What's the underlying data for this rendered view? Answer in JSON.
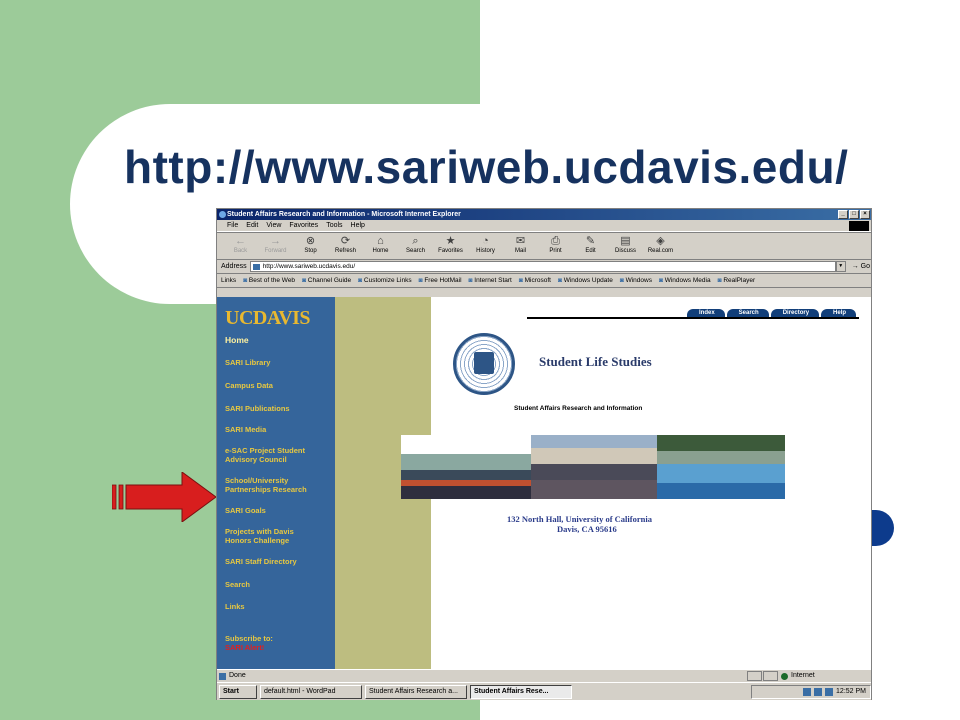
{
  "slide": {
    "title": "http://www.sariweb.ucdavis.edu/",
    "colors": {
      "green_panel": "#9ccb99",
      "title": "#16325f",
      "arrow": "#d81e1e",
      "bullet": "#0d3b8c"
    }
  },
  "window": {
    "title": "Student Affairs Research and Information - Microsoft Internet Explorer",
    "menu": [
      "File",
      "Edit",
      "View",
      "Favorites",
      "Tools",
      "Help"
    ],
    "toolbar": [
      {
        "label": "Back",
        "icon": "←"
      },
      {
        "label": "Forward",
        "icon": "→"
      },
      {
        "label": "Stop",
        "icon": "⊗"
      },
      {
        "label": "Refresh",
        "icon": "⟳"
      },
      {
        "label": "Home",
        "icon": "⌂"
      },
      {
        "label": "Search",
        "icon": "⌕"
      },
      {
        "label": "Favorites",
        "icon": "★"
      },
      {
        "label": "History",
        "icon": "◔"
      },
      {
        "label": "Mail",
        "icon": "✉"
      },
      {
        "label": "Print",
        "icon": "⎙"
      },
      {
        "label": "Edit",
        "icon": "✎"
      },
      {
        "label": "Discuss",
        "icon": "▤"
      },
      {
        "label": "Real.com",
        "icon": "◈"
      }
    ],
    "address_label": "Address",
    "address": "http://www.sariweb.ucdavis.edu/",
    "go": "Go",
    "links_label": "Links",
    "links": [
      "Best of the Web",
      "Channel Guide",
      "Customize Links",
      "Free HotMail",
      "Internet Start",
      "Microsoft",
      "Windows Update",
      "Windows",
      "Windows Media",
      "RealPlayer"
    ]
  },
  "site": {
    "logo": "UCDAVIS",
    "nav": [
      "Home",
      "SARI Library",
      "Campus Data",
      "SARI Publications",
      "SARI Media",
      "e-SAC Project Student Advisory Council",
      "School/University Partnerships Research",
      "SARI Goals",
      "Projects with Davis Honors Challenge",
      "SARI Staff Directory",
      "Search",
      "Links"
    ],
    "subscribe_label": "Subscribe to:",
    "subscribe_item": "SARI Alert!",
    "tabs": [
      "Index",
      "Search",
      "Directory",
      "Help"
    ],
    "heading": "Student Life Studies",
    "subheading": "Student Affairs Research and Information",
    "address_line1": "132 North Hall, University of California",
    "address_line2": "Davis, CA 95616"
  },
  "status": {
    "text": "Done",
    "zone": "Internet"
  },
  "taskbar": {
    "start": "Start",
    "tasks": [
      "default.html - WordPad",
      "Student Affairs Research a...",
      "Student Affairs Rese..."
    ],
    "clock": "12:52 PM"
  }
}
